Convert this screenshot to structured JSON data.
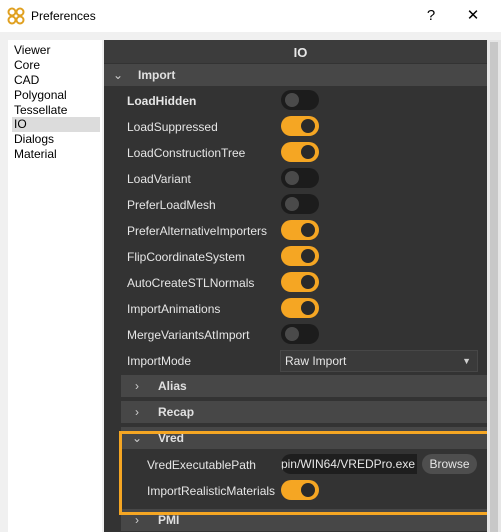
{
  "window": {
    "title": "Preferences",
    "help_glyph": "?",
    "close_glyph": "✕"
  },
  "sidebar": {
    "items": [
      "Viewer",
      "Core",
      "CAD",
      "Polygonal",
      "Tessellate",
      "IO",
      "Dialogs",
      "Material"
    ],
    "selected": "IO"
  },
  "panel": {
    "header": "IO",
    "import": {
      "label": "Import",
      "rows": [
        {
          "label": "LoadHidden",
          "on": false
        },
        {
          "label": "LoadSuppressed",
          "on": true
        },
        {
          "label": "LoadConstructionTree",
          "on": true
        },
        {
          "label": "LoadVariant",
          "on": false
        },
        {
          "label": "PreferLoadMesh",
          "on": false
        },
        {
          "label": "PreferAlternativeImporters",
          "on": true
        },
        {
          "label": "FlipCoordinateSystem",
          "on": true
        },
        {
          "label": "AutoCreateSTLNormals",
          "on": true
        },
        {
          "label": "ImportAnimations",
          "on": true
        },
        {
          "label": "MergeVariantsAtImport",
          "on": false
        }
      ],
      "import_mode": {
        "label": "ImportMode",
        "value": "Raw Import"
      }
    },
    "subsections": {
      "alias": "Alias",
      "recap": "Recap",
      "vred": "Vred",
      "pmi": "PMI"
    },
    "vred": {
      "exec_path_label": "VredExecutablePath",
      "exec_path_value": "pin/WIN64/VREDPro.exe",
      "browse_label": "Browse",
      "realistic_label": "ImportRealisticMaterials",
      "realistic_on": true
    }
  },
  "colors": {
    "accent": "#f5a623",
    "panel_bg": "#333333",
    "toggle_off": "#1c1c1c"
  },
  "icons": {
    "app": "autodesk-logo-icon",
    "expand": "chevron-down-icon",
    "collapse": "chevron-right-icon"
  }
}
